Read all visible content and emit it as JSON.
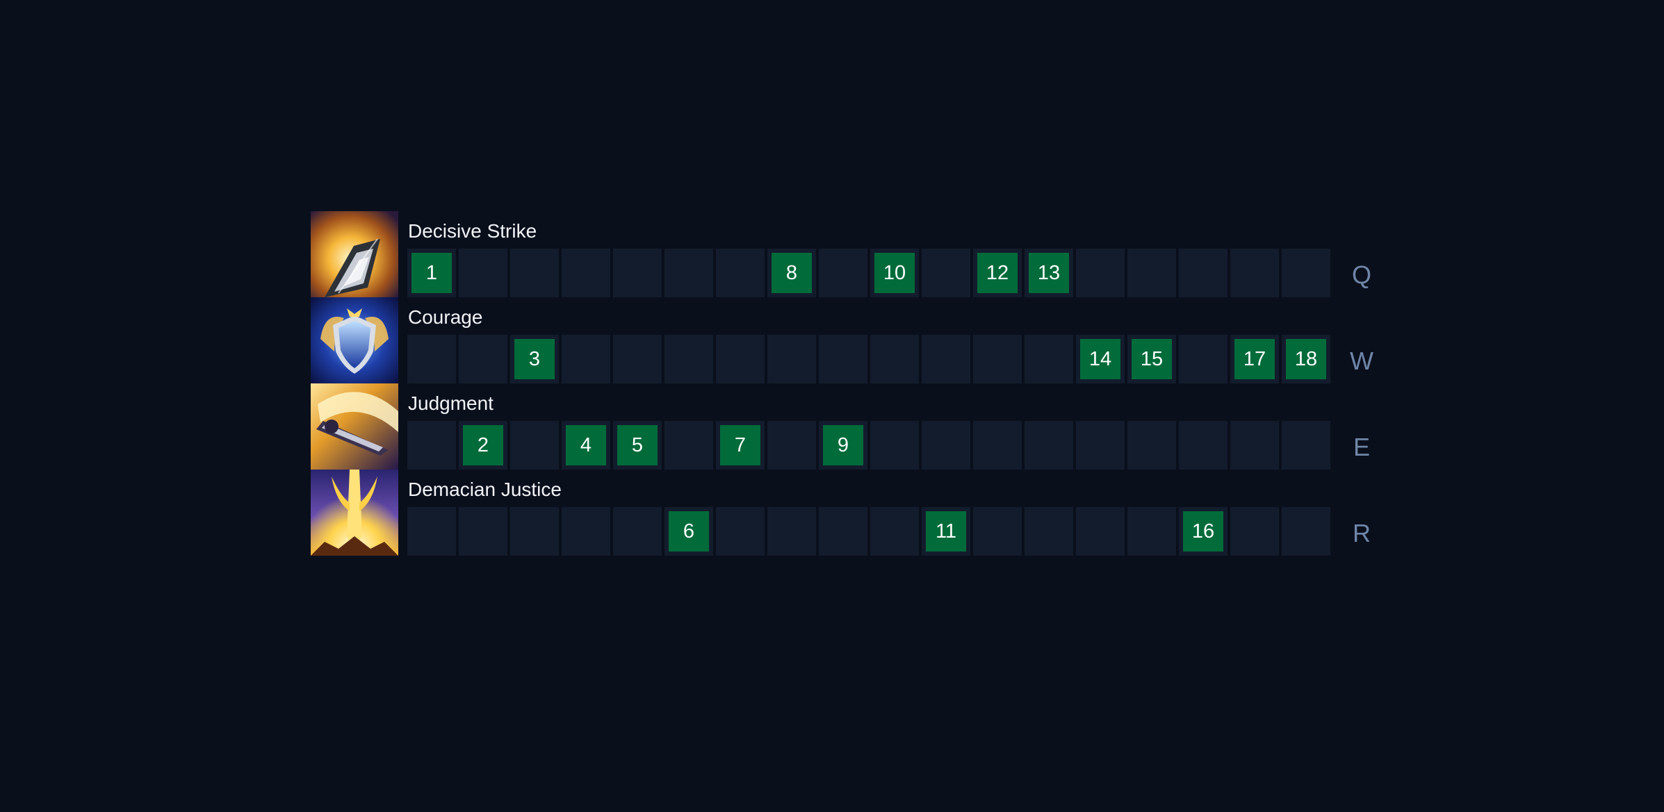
{
  "colors": {
    "background": "#0a0f1c",
    "cell": "#131c2c",
    "selected": "#016b3a",
    "name_text": "#f2f4f8",
    "hotkey_text": "#6f86a8"
  },
  "skills": [
    {
      "name": "Decisive Strike",
      "hotkey": "Q",
      "icon": "decisive-strike-icon",
      "levels": [
        "1",
        "",
        "",
        "",
        "",
        "",
        "",
        "8",
        "",
        "10",
        "",
        "12",
        "13",
        "",
        "",
        "",
        "",
        ""
      ]
    },
    {
      "name": "Courage",
      "hotkey": "W",
      "icon": "courage-icon",
      "levels": [
        "",
        "",
        "3",
        "",
        "",
        "",
        "",
        "",
        "",
        "",
        "",
        "",
        "",
        "14",
        "15",
        "",
        "17",
        "18"
      ]
    },
    {
      "name": "Judgment",
      "hotkey": "E",
      "icon": "judgment-icon",
      "levels": [
        "",
        "2",
        "",
        "4",
        "5",
        "",
        "7",
        "",
        "9",
        "",
        "",
        "",
        "",
        "",
        "",
        "",
        "",
        ""
      ]
    },
    {
      "name": "Demacian Justice",
      "hotkey": "R",
      "icon": "demacian-justice-icon",
      "levels": [
        "",
        "",
        "",
        "",
        "",
        "6",
        "",
        "",
        "",
        "",
        "11",
        "",
        "",
        "",
        "",
        "16",
        "",
        ""
      ]
    }
  ]
}
